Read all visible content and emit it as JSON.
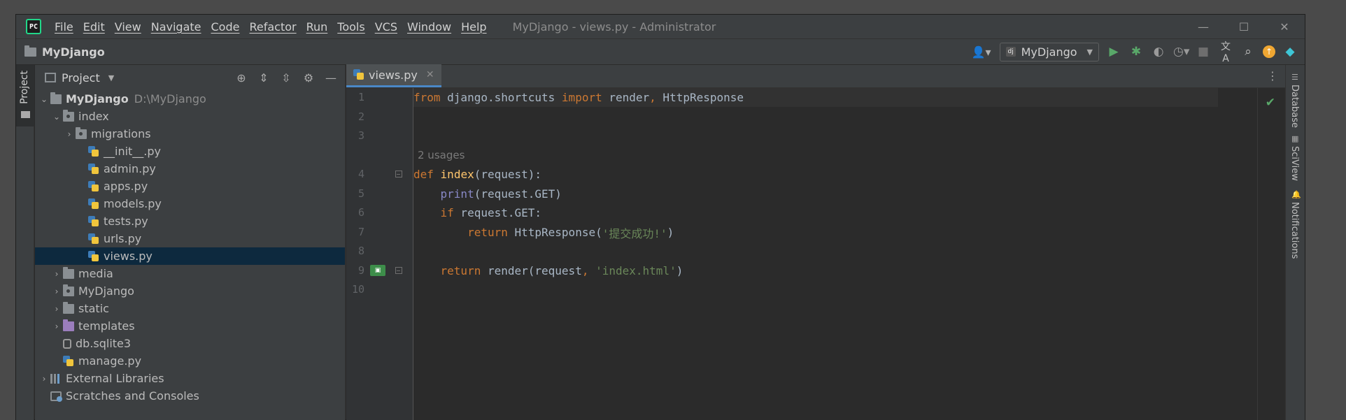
{
  "titlebar": {
    "logo_text": "PC",
    "menu": [
      "File",
      "Edit",
      "View",
      "Navigate",
      "Code",
      "Refactor",
      "Run",
      "Tools",
      "VCS",
      "Window",
      "Help"
    ],
    "window_title": "MyDjango - views.py - Administrator",
    "controls": {
      "minimize": "—",
      "maximize": "☐",
      "close": "✕"
    }
  },
  "navbar": {
    "breadcrumb": "MyDjango",
    "run_config": "MyDjango",
    "run_config_badge": "dj"
  },
  "left_stripe": {
    "tab_label": "Project"
  },
  "project": {
    "title": "Project",
    "tree": [
      {
        "label": "MyDjango",
        "detail": "D:\\MyDjango"
      },
      {
        "label": "index"
      },
      {
        "label": "migrations"
      },
      {
        "label": "__init__.py"
      },
      {
        "label": "admin.py"
      },
      {
        "label": "apps.py"
      },
      {
        "label": "models.py"
      },
      {
        "label": "tests.py"
      },
      {
        "label": "urls.py"
      },
      {
        "label": "views.py"
      },
      {
        "label": "media"
      },
      {
        "label": "MyDjango"
      },
      {
        "label": "static"
      },
      {
        "label": "templates"
      },
      {
        "label": "db.sqlite3"
      },
      {
        "label": "manage.py"
      },
      {
        "label": "External Libraries"
      },
      {
        "label": "Scratches and Consoles"
      }
    ]
  },
  "editor": {
    "tab": "views.py",
    "usages_hint": "2 usages",
    "line_numbers": [
      "1",
      "2",
      "3",
      "4",
      "5",
      "6",
      "7",
      "8",
      "9",
      "10"
    ],
    "code": {
      "l1": [
        "from",
        " django.shortcuts ",
        "import",
        " render",
        ",",
        " HttpResponse"
      ],
      "l4": [
        "def",
        " ",
        "index",
        "(request):"
      ],
      "l5": [
        "    ",
        "print",
        "(request.GET)"
      ],
      "l6": [
        "    ",
        "if",
        " request.GET:"
      ],
      "l7": [
        "        ",
        "return",
        " HttpResponse(",
        "'提交成功!'",
        ")"
      ],
      "l9": [
        "    ",
        "return",
        " render(request",
        ",",
        " ",
        "'index.html'",
        ")"
      ]
    }
  },
  "right_stripe": [
    "Database",
    "SciView",
    "Notifications"
  ],
  "colors": {
    "keyword": "#cc7832",
    "function": "#ffc66d",
    "builtin": "#8888c6",
    "string": "#6a8759",
    "selection": "#0d293e",
    "accent": "#4a88c7"
  }
}
